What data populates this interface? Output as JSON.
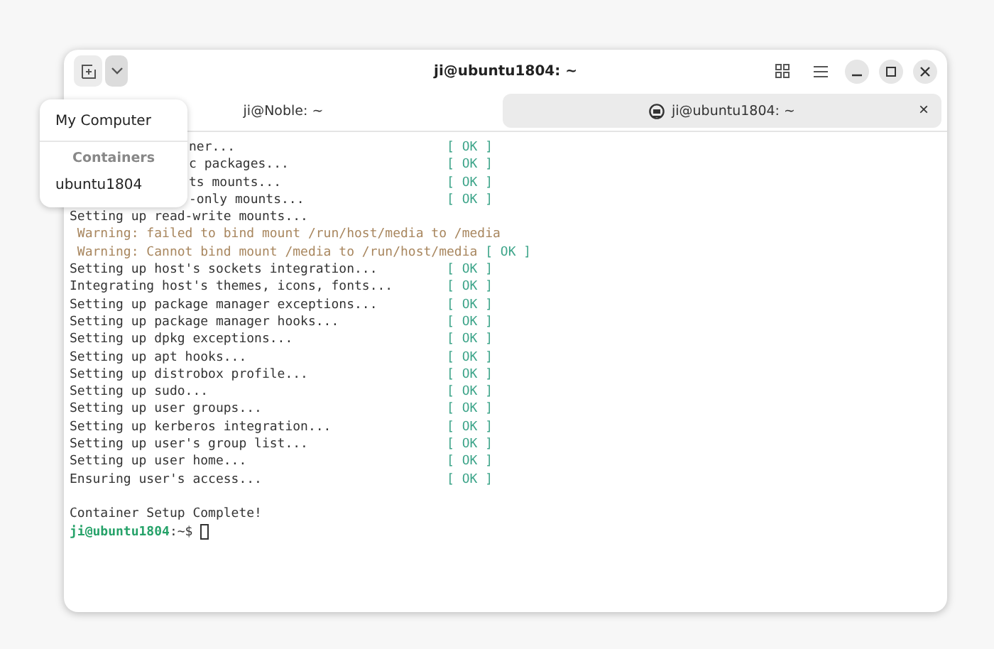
{
  "window": {
    "title": "ji@ubuntu1804: ~",
    "profile_menu_expanded": true
  },
  "tabs": [
    {
      "label": "ji@Noble: ~",
      "selected": false
    },
    {
      "label": "ji@ubuntu1804: ~",
      "selected": true,
      "close": "×"
    }
  ],
  "profile_menu": {
    "items": [
      {
        "kind": "item",
        "label": "My Computer"
      },
      {
        "kind": "header",
        "label": "Containers"
      },
      {
        "kind": "item",
        "label": "ubuntu1804"
      }
    ]
  },
  "terminal": {
    "lines": [
      {
        "kind": "partial",
        "text": "ner...",
        "status": "[ OK ]"
      },
      {
        "kind": "partial",
        "text": "c packages...",
        "status": "[ OK ]"
      },
      {
        "kind": "partial",
        "text": "ts mounts...",
        "status": "[ OK ]"
      },
      {
        "kind": "partial",
        "text": "-only mounts...",
        "status": "[ OK ]"
      },
      {
        "kind": "plain",
        "text": "Setting up read-write mounts..."
      },
      {
        "kind": "warning",
        "text": " Warning: failed to bind mount /run/host/media to /media"
      },
      {
        "kind": "warning",
        "text": " Warning: Cannot bind mount /media to /run/host/media",
        "status": "[ OK ]"
      },
      {
        "kind": "step",
        "text": "Setting up host's sockets integration...",
        "status": "[ OK ]"
      },
      {
        "kind": "step",
        "text": "Integrating host's themes, icons, fonts...",
        "status": "[ OK ]"
      },
      {
        "kind": "step",
        "text": "Setting up package manager exceptions...",
        "status": "[ OK ]"
      },
      {
        "kind": "step",
        "text": "Setting up package manager hooks...",
        "status": "[ OK ]"
      },
      {
        "kind": "step",
        "text": "Setting up dpkg exceptions...",
        "status": "[ OK ]"
      },
      {
        "kind": "step",
        "text": "Setting up apt hooks...",
        "status": "[ OK ]"
      },
      {
        "kind": "step",
        "text": "Setting up distrobox profile...",
        "status": "[ OK ]"
      },
      {
        "kind": "step",
        "text": "Setting up sudo...",
        "status": "[ OK ]"
      },
      {
        "kind": "step",
        "text": "Setting up user groups...",
        "status": "[ OK ]"
      },
      {
        "kind": "step",
        "text": "Setting up kerberos integration...",
        "status": "[ OK ]"
      },
      {
        "kind": "step",
        "text": "Setting up user's group list...",
        "status": "[ OK ]"
      },
      {
        "kind": "step",
        "text": "Setting up user home...",
        "status": "[ OK ]"
      },
      {
        "kind": "step",
        "text": "Ensuring user's access...",
        "status": "[ OK ]"
      },
      {
        "kind": "blank"
      },
      {
        "kind": "plain",
        "text": "Container Setup Complete!"
      },
      {
        "kind": "prompt",
        "user": "ji@ubuntu1804",
        "text": ":~$"
      }
    ]
  }
}
